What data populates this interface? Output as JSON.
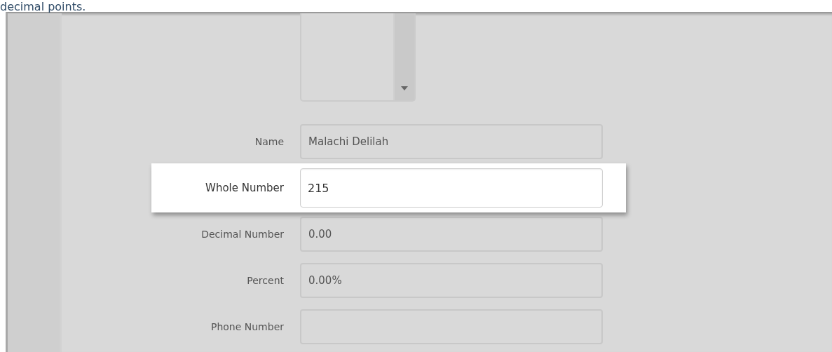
{
  "intro_text": "decimal points.",
  "listbox": {
    "kind": "listbox"
  },
  "fields": [
    {
      "label": "Name",
      "value": "Malachi Delilah",
      "highlighted": false
    },
    {
      "label": "Whole Number",
      "value": "215",
      "highlighted": true
    },
    {
      "label": "Decimal Number",
      "value": "0.00",
      "highlighted": false
    },
    {
      "label": "Percent",
      "value": "0.00%",
      "highlighted": false
    },
    {
      "label": "Phone Number",
      "highlighted": false
    }
  ]
}
